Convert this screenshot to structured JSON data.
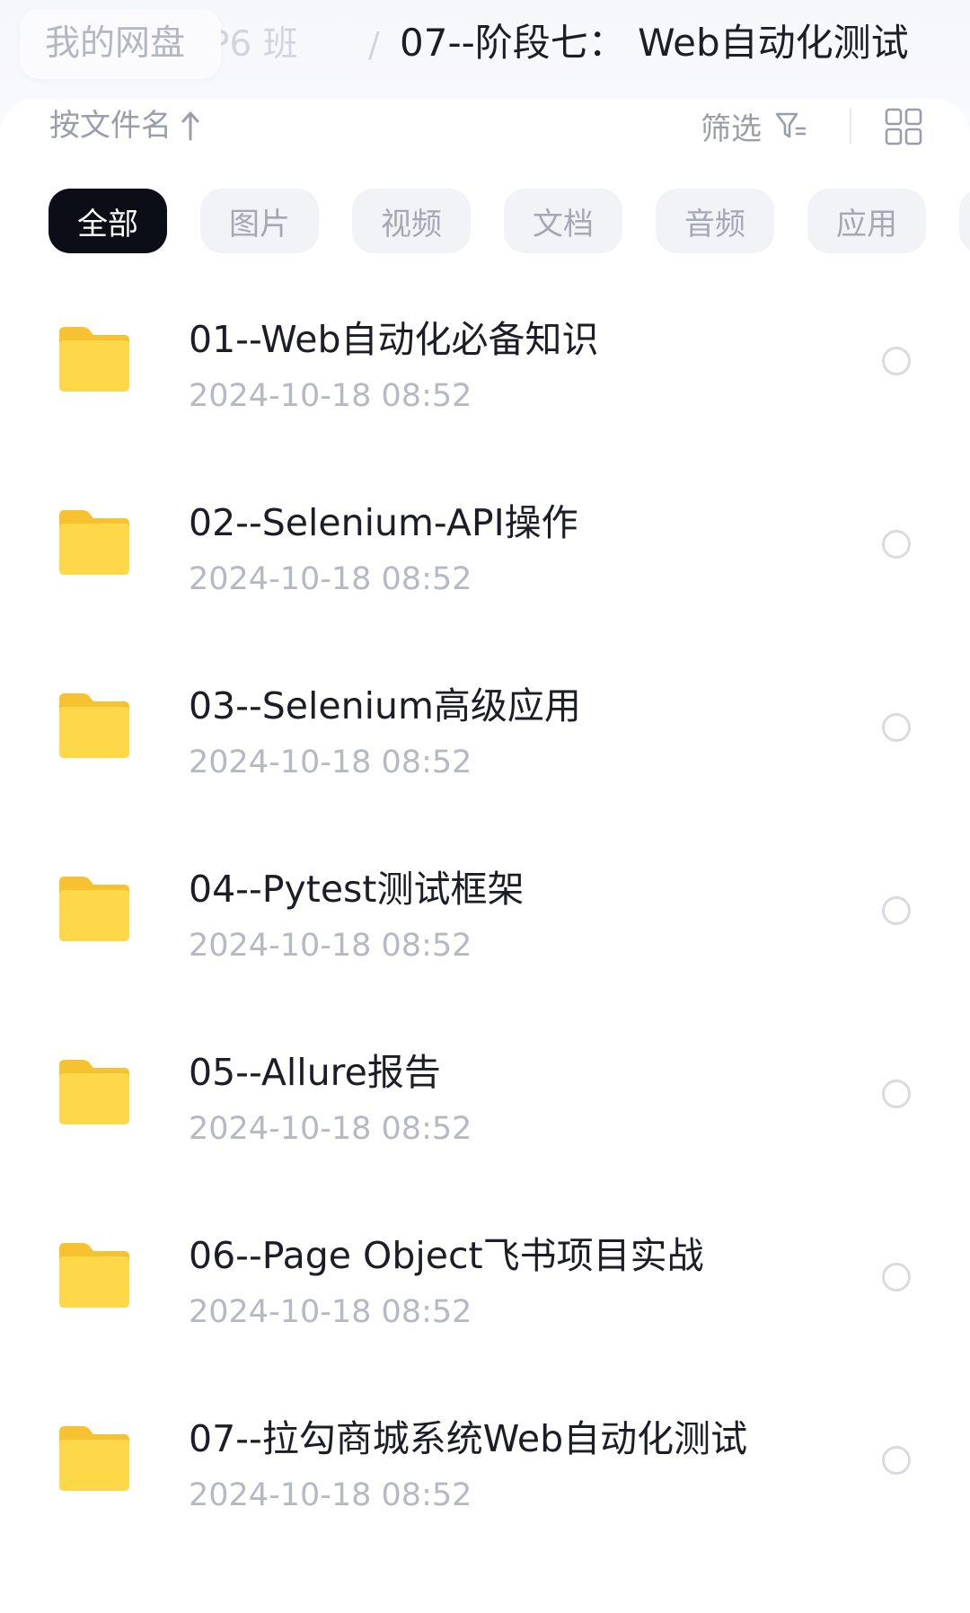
{
  "breadcrumb": {
    "home": "我的网盘",
    "middle": "P6 班",
    "separator": "/",
    "current": "07--阶段七： Web自动化测试"
  },
  "toolbar": {
    "sort_label": "按文件名",
    "filter_label": "筛选",
    "icons": [
      "sort-arrow-up-icon",
      "filter-icon",
      "grid-view-icon"
    ]
  },
  "categories": [
    "全部",
    "图片",
    "视频",
    "文档",
    "音频",
    "应用"
  ],
  "active_category": "全部",
  "files": [
    {
      "name": "01--Web自动化必备知识",
      "date": "2024-10-18  08:52"
    },
    {
      "name": "02--Selenium-API操作",
      "date": "2024-10-18  08:52"
    },
    {
      "name": "03--Selenium高级应用",
      "date": "2024-10-18  08:52"
    },
    {
      "name": "04--Pytest测试框架",
      "date": "2024-10-18  08:52"
    },
    {
      "name": "05--Allure报告",
      "date": "2024-10-18  08:52"
    },
    {
      "name": "06--Page Object飞书项目实战",
      "date": "2024-10-18  08:52"
    },
    {
      "name": "07--拉勾商城系统Web自动化测试",
      "date": "2024-10-18  08:52"
    }
  ],
  "colors": {
    "folder": "#ffd43f",
    "active_chip": "#0b0d17",
    "chip_bg": "#f2f3f6",
    "muted_text": "#b6b9c4"
  }
}
